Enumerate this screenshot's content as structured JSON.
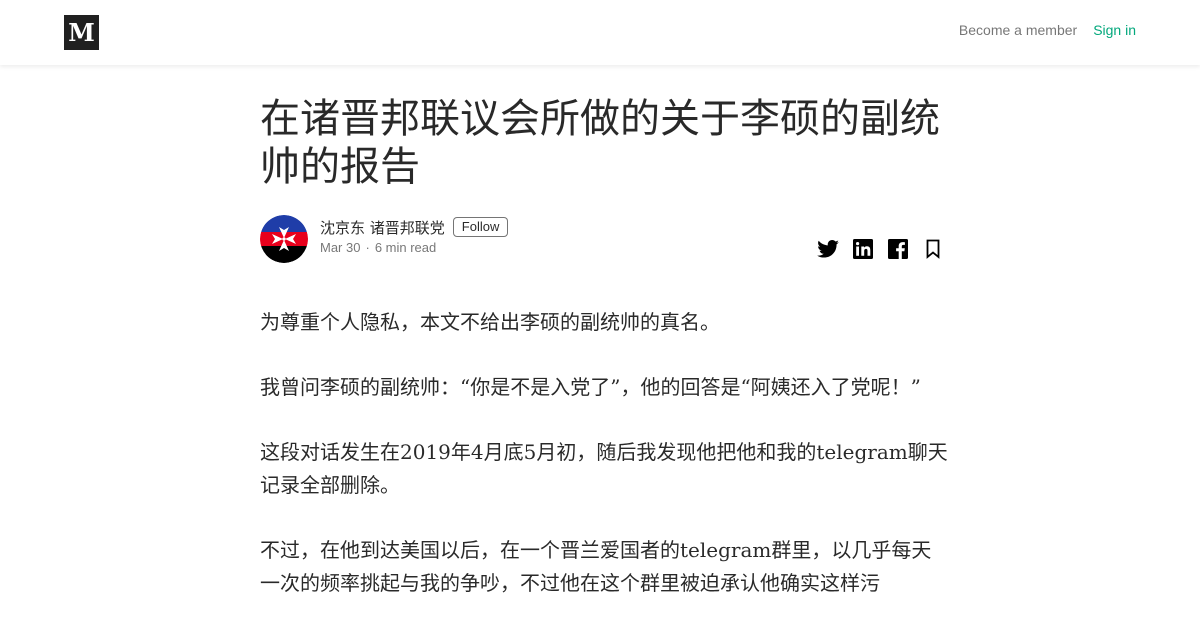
{
  "header": {
    "logo_letter": "M",
    "become_member": "Become a member",
    "sign_in": "Sign in"
  },
  "article": {
    "title": "在诸晋邦联议会所做的关于李硕的副统帅的报告",
    "author": "沈京东 诸晋邦联党",
    "follow_label": "Follow",
    "date": "Mar 30",
    "separator": "·",
    "read_time": "6 min read",
    "paragraphs": [
      "为尊重个人隐私，本文不给出李硕的副统帅的真名。",
      "我曾问李硕的副统帅：“你是不是入党了”，他的回答是“阿姨还入了党呢！”",
      "这段对话发生在2019年4月底5月初，随后我发现他把他和我的telegram聊天记录全部删除。",
      "不过，在他到达美国以后，在一个晋兰爱国者的telegram群里，以几乎每天一次的频率挑起与我的争吵，不过他在这个群里被迫承认他确实这样污"
    ]
  },
  "share": {
    "icons": [
      "twitter-icon",
      "linkedin-icon",
      "facebook-icon",
      "bookmark-icon"
    ]
  },
  "colors": {
    "accent_green": "#03a87c",
    "logo_bg": "#202020",
    "avatar_blue": "#1f3da8",
    "avatar_red": "#e8001c",
    "avatar_black": "#000000"
  }
}
